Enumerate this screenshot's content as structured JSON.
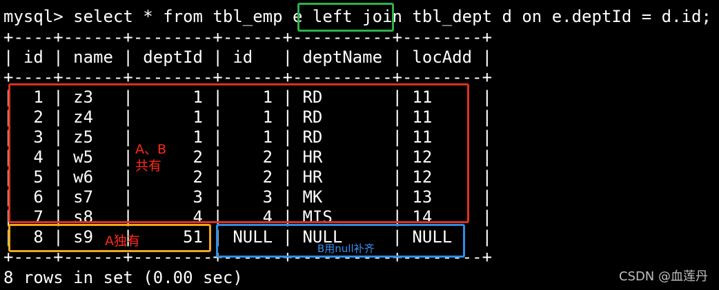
{
  "terminal": {
    "command_line": "mysql> select * from tbl_emp e left join tbl_dept d on e.deptId = d.id;",
    "border_top": "+----+------+--------+------+----------+--------+",
    "header_row": "| id | name | deptId | id   | deptName | locAdd |",
    "border_mid": "+----+------+--------+------+----------+--------+",
    "rows": [
      "|  1 | z3   |      1 |    1 | RD       | 11     |",
      "|  2 | z4   |      1 |    1 | RD       | 11     |",
      "|  3 | z5   |      1 |    1 | RD       | 11     |",
      "|  4 | w5   |      2 |    2 | HR       | 12     |",
      "|  5 | w6   |      2 |    2 | HR       | 12     |",
      "|  6 | s7   |      3 |    3 | MK       | 13     |",
      "|  7 | s8   |      4 |    4 | MIS      | 14     |",
      "|  8 | s9   |     51 | NULL | NULL     | NULL   |"
    ],
    "border_bottom": "+----+------+--------+------+----------+--------+",
    "result_line": "8 rows in set (0.00 sec)"
  },
  "annotations": {
    "shared_label_line1": "A、B",
    "shared_label_line2": "共有",
    "a_only_label": "A独有",
    "b_null_label": "B用null补齐"
  },
  "colors": {
    "green_box": "#2db24a",
    "red_box": "#e0301e",
    "orange_box": "#f0a818",
    "blue_box": "#2f8de4",
    "red_text": "#ff2a1a",
    "blue_text": "#3a8ef0"
  },
  "watermark": "CSDN @血莲丹"
}
